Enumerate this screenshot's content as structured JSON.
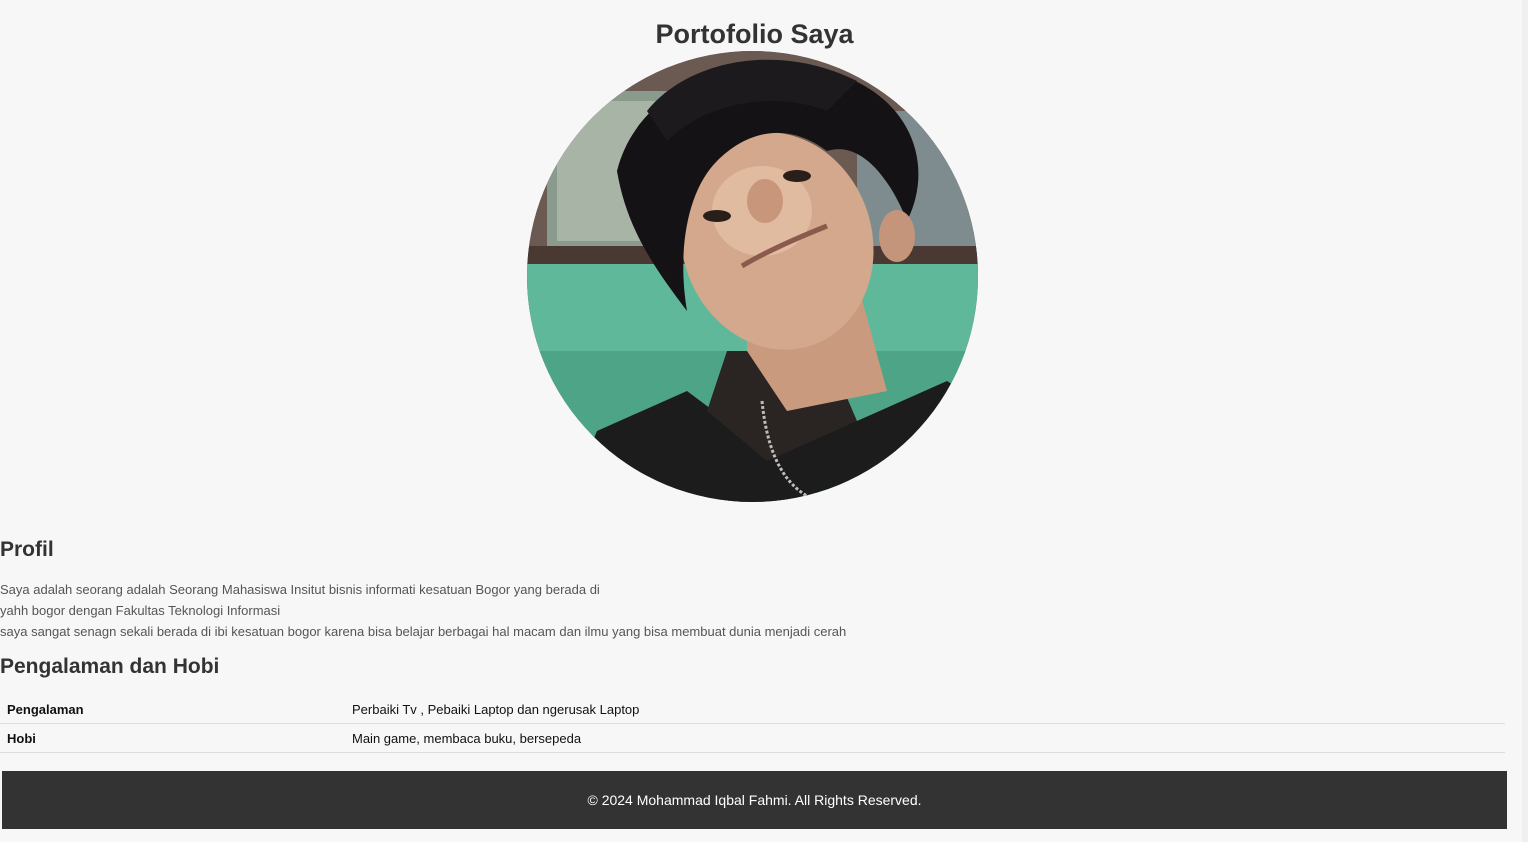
{
  "header": {
    "title": "Portofolio Saya"
  },
  "profile_photo": {
    "alt": "profile photo"
  },
  "profile": {
    "heading": "Profil",
    "lines": [
      "Saya adalah seorang adalah Seorang Mahasiswa Insitut bisnis informati kesatuan Bogor yang berada di",
      "yahh bogor dengan Fakultas Teknologi Informasi",
      "saya sangat senagn sekali berada di ibi kesatuan bogor karena bisa belajar berbagai hal macam dan ilmu yang bisa membuat dunia menjadi cerah"
    ]
  },
  "experience": {
    "heading": "Pengalaman dan Hobi",
    "rows": [
      {
        "label": "Pengalaman",
        "value": "Perbaiki Tv , Pebaiki Laptop dan ngerusak Laptop"
      },
      {
        "label": "Hobi",
        "value": "Main game, membaca buku, bersepeda"
      }
    ]
  },
  "footer": {
    "text": "© 2024 Mohammad Iqbal Fahmi. All Rights Reserved."
  },
  "colors": {
    "page_bg": "#f7f7f7",
    "footer_bg": "#333333",
    "heading": "#333333",
    "body_text": "#555555"
  }
}
